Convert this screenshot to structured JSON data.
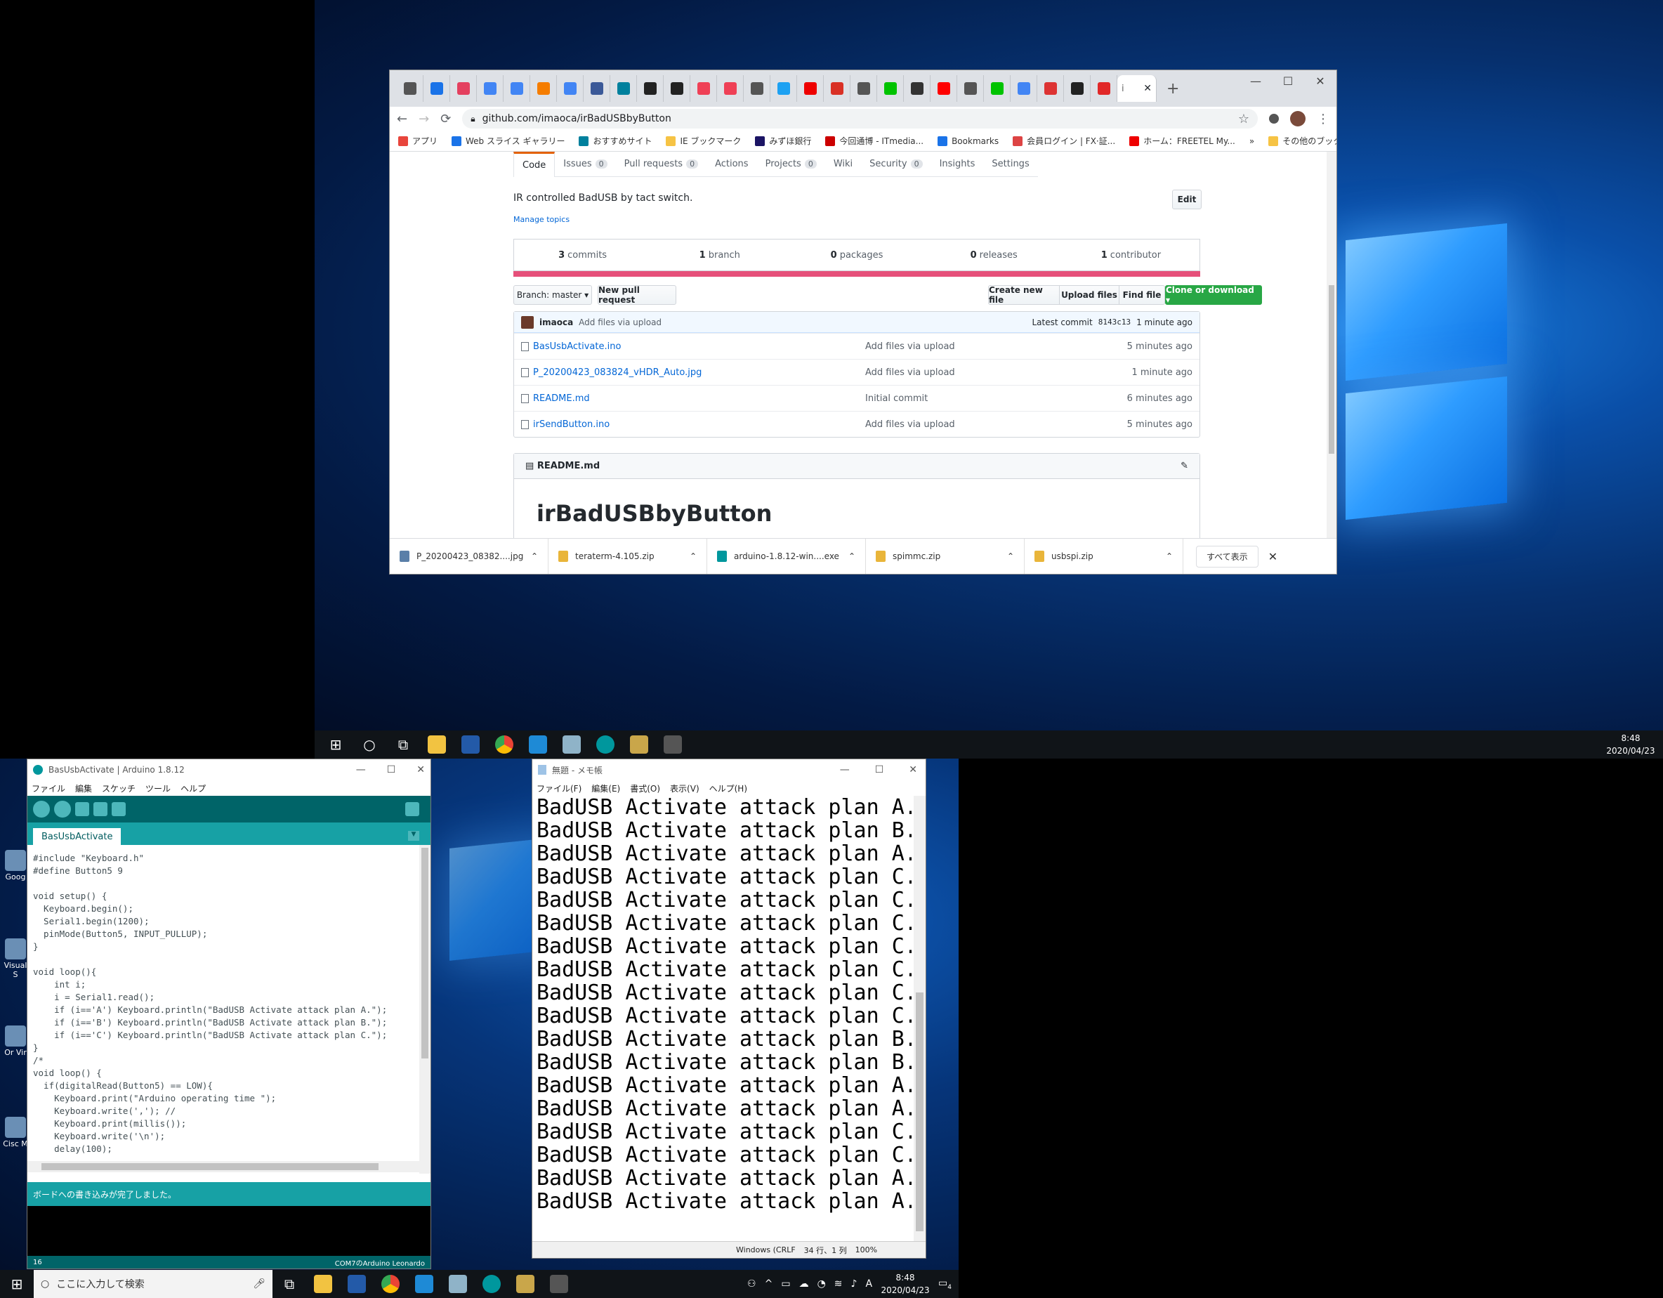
{
  "chrome": {
    "tabs": [
      {
        "icon": "info-icon",
        "color": "#555"
      },
      {
        "icon": "calendar-icon",
        "color": "#1a73e8"
      },
      {
        "icon": "instagram-icon",
        "color": "#e4405f"
      },
      {
        "icon": "google-icon",
        "color": "#4285f4"
      },
      {
        "icon": "google-icon",
        "color": "#4285f4"
      },
      {
        "icon": "blogger-icon",
        "color": "#f57d00"
      },
      {
        "icon": "google-icon",
        "color": "#4285f4"
      },
      {
        "icon": "facebook-icon",
        "color": "#3b5998"
      },
      {
        "icon": "bing-icon",
        "color": "#00809d"
      },
      {
        "icon": "tab-icon",
        "color": "#222"
      },
      {
        "icon": "tab-icon",
        "color": "#222"
      },
      {
        "icon": "pocket-icon",
        "color": "#ef4056"
      },
      {
        "icon": "pocket-icon",
        "color": "#ef4056"
      },
      {
        "icon": "globe-icon",
        "color": "#555"
      },
      {
        "icon": "twitter-icon",
        "color": "#1da1f2"
      },
      {
        "icon": "yahoo-icon",
        "color": "#e00"
      },
      {
        "icon": "gmail-icon",
        "color": "#d93025"
      },
      {
        "icon": "globe-icon",
        "color": "#555"
      },
      {
        "icon": "line-icon",
        "color": "#00c300"
      },
      {
        "icon": "tab-icon",
        "color": "#333"
      },
      {
        "icon": "youtube-icon",
        "color": "#f00"
      },
      {
        "icon": "globe-icon",
        "color": "#555"
      },
      {
        "icon": "line-icon",
        "color": "#00c300"
      },
      {
        "icon": "google-icon",
        "color": "#4285f4"
      },
      {
        "icon": "tab-icon",
        "color": "#d33"
      },
      {
        "icon": "github-icon",
        "color": "#222"
      },
      {
        "icon": "flipboard-icon",
        "color": "#e12828"
      }
    ],
    "active_tab_favicon": "i",
    "new_tab": "+",
    "url": "github.com/imaoca/irBadUSBbyButton",
    "bookmarks": [
      {
        "label": "アプリ",
        "color": "#e8453c"
      },
      {
        "label": "Web スライス ギャラリー",
        "color": "#1a73e8"
      },
      {
        "label": "おすすめサイト",
        "color": "#00809d"
      },
      {
        "label": "IE ブックマーク",
        "color": "#f6c344"
      },
      {
        "label": "みずほ銀行",
        "color": "#1b1464"
      },
      {
        "label": "今回通博 - ITmedia...",
        "color": "#c00"
      },
      {
        "label": "Bookmarks",
        "color": "#1a73e8"
      },
      {
        "label": "会員ログイン | FX·証...",
        "color": "#d44"
      },
      {
        "label": "ホーム：FREETEL My...",
        "color": "#e00"
      }
    ],
    "bookmarks_more": "»",
    "other_bookmarks": "その他のブックマーク",
    "repo_nav": [
      {
        "label": "Code",
        "count": ""
      },
      {
        "label": "Issues",
        "count": "0"
      },
      {
        "label": "Pull requests",
        "count": "0"
      },
      {
        "label": "Actions",
        "count": ""
      },
      {
        "label": "Projects",
        "count": "0"
      },
      {
        "label": "Wiki",
        "count": ""
      },
      {
        "label": "Security",
        "count": "0"
      },
      {
        "label": "Insights",
        "count": ""
      },
      {
        "label": "Settings",
        "count": ""
      }
    ],
    "description": "IR controlled BadUSB by tact switch.",
    "edit_label": "Edit",
    "manage_topics": "Manage topics",
    "summary": [
      {
        "num": "3",
        "label": "commits"
      },
      {
        "num": "1",
        "label": "branch"
      },
      {
        "num": "0",
        "label": "packages"
      },
      {
        "num": "0",
        "label": "releases"
      },
      {
        "num": "1",
        "label": "contributor"
      }
    ],
    "branch_label": "Branch: master ▾",
    "new_pr": "New pull request",
    "create_file": "Create new file",
    "upload_files": "Upload files",
    "find_file": "Find file",
    "clone": "Clone or download ▾",
    "commit": {
      "author": "imaoca",
      "message": "Add files via upload",
      "latest": "Latest commit",
      "sha": "8143c13",
      "age": "1 minute ago"
    },
    "files": [
      {
        "name": "BasUsbActivate.ino",
        "msg": "Add files via upload",
        "age": "5 minutes ago"
      },
      {
        "name": "P_20200423_083824_vHDR_Auto.jpg",
        "msg": "Add files via upload",
        "age": "1 minute ago"
      },
      {
        "name": "README.md",
        "msg": "Initial commit",
        "age": "6 minutes ago"
      },
      {
        "name": "irSendButton.ino",
        "msg": "Add files via upload",
        "age": "5 minutes ago"
      }
    ],
    "readme_label": "README.md",
    "readme_title": "irBadUSBbyButton",
    "downloads": [
      {
        "name": "P_20200423_08382....jpg",
        "color": "#5a7fa8"
      },
      {
        "name": "teraterm-4.105.zip",
        "color": "#e9b53a"
      },
      {
        "name": "arduino-1.8.12-win....exe",
        "color": "#00979d"
      },
      {
        "name": "spimmc.zip",
        "color": "#e9b53a"
      },
      {
        "name": "usbspi.zip",
        "color": "#e9b53a"
      }
    ],
    "show_all": "すべて表示"
  },
  "taskbar_top": {
    "time": "8:48",
    "date": "2020/04/23"
  },
  "arduino": {
    "title": "BasUsbActivate | Arduino 1.8.12",
    "menu": [
      "ファイル",
      "編集",
      "スケッチ",
      "ツール",
      "ヘルプ"
    ],
    "tab": "BasUsbActivate",
    "code": "#include \"Keyboard.h\"\n#define Button5 9\n\nvoid setup() {\n  Keyboard.begin();\n  Serial1.begin(1200);\n  pinMode(Button5, INPUT_PULLUP);\n}\n\nvoid loop(){\n    int i;\n    i = Serial1.read();\n    if (i=='A') Keyboard.println(\"BadUSB Activate attack plan A.\");\n    if (i=='B') Keyboard.println(\"BadUSB Activate attack plan B.\");\n    if (i=='C') Keyboard.println(\"BadUSB Activate attack plan C.\");\n}\n/*\nvoid loop() {\n  if(digitalRead(Button5) == LOW){\n    Keyboard.print(\"Arduino operating time \");\n    Keyboard.write(','); //\n    Keyboard.print(millis());\n    Keyboard.write('\\n');\n    delay(100);",
    "status": "ボードへの書き込みが完了しました。",
    "line": "16",
    "board": "COM7のArduino Leonardo"
  },
  "notepad": {
    "title": "無題 - メモ帳",
    "menu": [
      "ファイル(F)",
      "編集(E)",
      "書式(O)",
      "表示(V)",
      "ヘルプ(H)"
    ],
    "text": "BadUSB Activate attack plan A.\nBadUSB Activate attack plan B.\nBadUSB Activate attack plan A.\nBadUSB Activate attack plan C.\nBadUSB Activate attack plan C.\nBadUSB Activate attack plan C.\nBadUSB Activate attack plan C.\nBadUSB Activate attack plan C.\nBadUSB Activate attack plan C.\nBadUSB Activate attack plan C.\nBadUSB Activate attack plan B.\nBadUSB Activate attack plan B.\nBadUSB Activate attack plan A.\nBadUSB Activate attack plan A.\nBadUSB Activate attack plan C.\nBadUSB Activate attack plan C.\nBadUSB Activate attack plan A.\nBadUSB Activate attack plan A.",
    "encoding": "Windows (CRLF",
    "position": "34 行、1 列",
    "zoom": "100%"
  },
  "desktop_icons": [
    "Goog",
    "Visual S",
    "Or Vir",
    "Cisc M"
  ],
  "taskbar_bottom": {
    "search_placeholder": "ここに入力して検索",
    "time": "8:48",
    "date": "2020/04/23",
    "ime": "A",
    "notif": "4"
  }
}
